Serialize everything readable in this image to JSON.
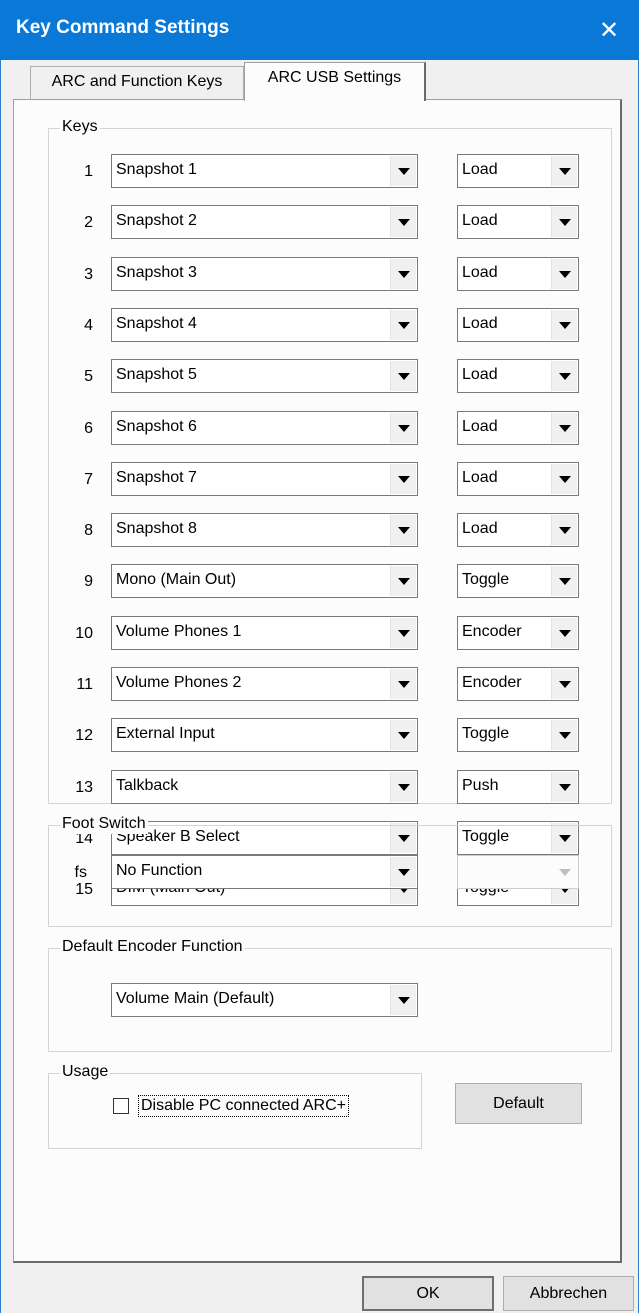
{
  "window": {
    "title": "Key Command Settings",
    "close_icon": "close-icon"
  },
  "tabs": [
    {
      "label": "ARC and Function Keys",
      "active": false
    },
    {
      "label": "ARC USB Settings",
      "active": true
    }
  ],
  "keys_group": {
    "legend": "Keys",
    "rows": [
      {
        "num": "1",
        "function": "Snapshot 1",
        "mode": "Load"
      },
      {
        "num": "2",
        "function": "Snapshot 2",
        "mode": "Load"
      },
      {
        "num": "3",
        "function": "Snapshot 3",
        "mode": "Load"
      },
      {
        "num": "4",
        "function": "Snapshot 4",
        "mode": "Load"
      },
      {
        "num": "5",
        "function": "Snapshot 5",
        "mode": "Load"
      },
      {
        "num": "6",
        "function": "Snapshot 6",
        "mode": "Load"
      },
      {
        "num": "7",
        "function": "Snapshot 7",
        "mode": "Load"
      },
      {
        "num": "8",
        "function": "Snapshot 8",
        "mode": "Load"
      },
      {
        "num": "9",
        "function": "Mono (Main Out)",
        "mode": "Toggle"
      },
      {
        "num": "10",
        "function": "Volume Phones 1",
        "mode": "Encoder"
      },
      {
        "num": "11",
        "function": "Volume Phones 2",
        "mode": "Encoder"
      },
      {
        "num": "12",
        "function": "External Input",
        "mode": "Toggle"
      },
      {
        "num": "13",
        "function": "Talkback",
        "mode": "Push"
      },
      {
        "num": "14",
        "function": "Speaker B Select",
        "mode": "Toggle"
      },
      {
        "num": "15",
        "function": "DIM (Main Out)",
        "mode": "Toggle"
      }
    ]
  },
  "foot_switch": {
    "legend": "Foot Switch",
    "label": "fs",
    "function": "No Function",
    "mode": ""
  },
  "encoder": {
    "legend": "Default Encoder Function",
    "function": "Volume Main (Default)"
  },
  "usage": {
    "legend": "Usage",
    "checkbox_label": "Disable PC connected ARC+",
    "checked": false
  },
  "buttons": {
    "default": "Default",
    "ok": "OK",
    "cancel": "Abbrechen"
  },
  "colors": {
    "titlebar": "#0a78d7",
    "panel": "#fcfcfc",
    "window": "#f0f0f0"
  }
}
